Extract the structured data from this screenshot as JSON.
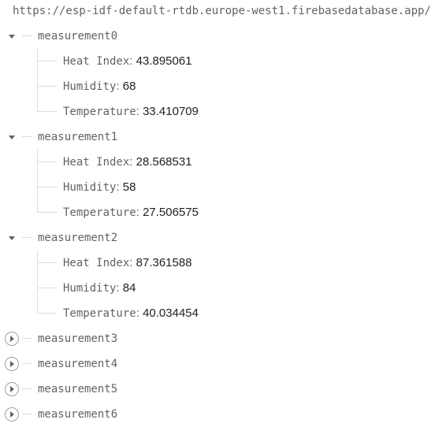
{
  "root": {
    "url": "https://esp-idf-default-rtdb.europe-west1.firebasedatabase.app/"
  },
  "colors": {
    "key": "#5f6368",
    "value": "#202124",
    "tree_line": "#dadce0"
  },
  "icons": {
    "expanded": "caret-down-icon",
    "collapsed": "caret-right-circle-icon"
  },
  "nodes": [
    {
      "key": "measurement0",
      "expanded": true,
      "children": [
        {
          "key": "Heat Index",
          "value": "43.895061"
        },
        {
          "key": "Humidity",
          "value": "68"
        },
        {
          "key": "Temperature",
          "value": "33.410709"
        }
      ]
    },
    {
      "key": "measurement1",
      "expanded": true,
      "children": [
        {
          "key": "Heat Index",
          "value": "28.568531"
        },
        {
          "key": "Humidity",
          "value": "58"
        },
        {
          "key": "Temperature",
          "value": "27.506575"
        }
      ]
    },
    {
      "key": "measurement2",
      "expanded": true,
      "children": [
        {
          "key": "Heat Index",
          "value": "87.361588"
        },
        {
          "key": "Humidity",
          "value": "84"
        },
        {
          "key": "Temperature",
          "value": "40.034454"
        }
      ]
    },
    {
      "key": "measurement3",
      "expanded": false,
      "children": []
    },
    {
      "key": "measurement4",
      "expanded": false,
      "children": []
    },
    {
      "key": "measurement5",
      "expanded": false,
      "children": []
    },
    {
      "key": "measurement6",
      "expanded": false,
      "children": []
    }
  ]
}
